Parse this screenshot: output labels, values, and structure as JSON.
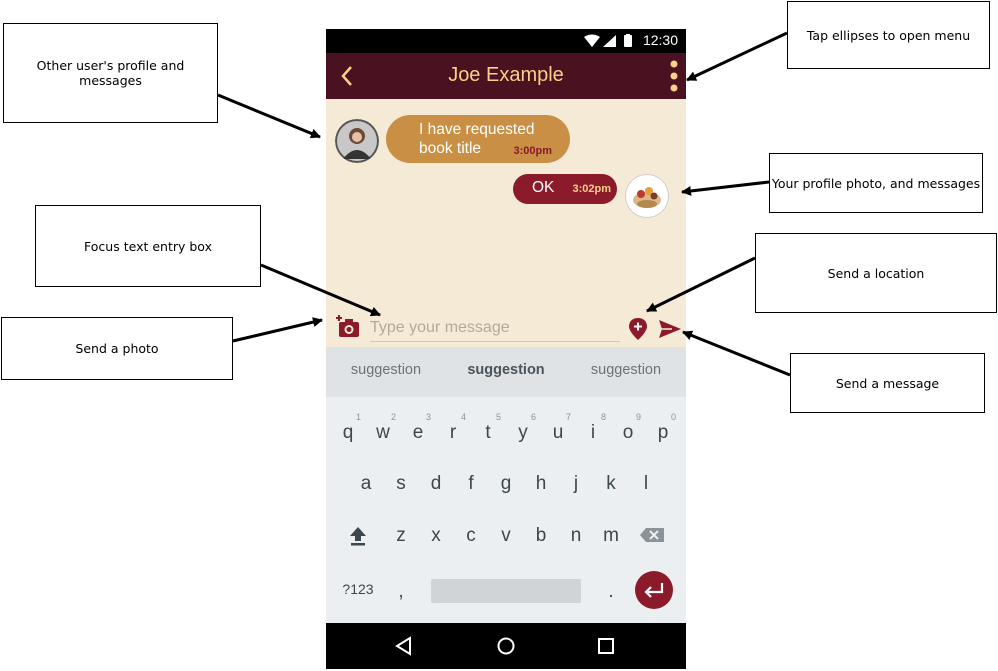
{
  "callouts": {
    "other_user": "Other user's profile and messages",
    "menu": "Tap ellipses to open menu",
    "your_profile": "Your profile photo, and messages",
    "focus_text": "Focus text entry box",
    "send_location": "Send a location",
    "send_photo": "Send a photo",
    "send_message": "Send a message"
  },
  "status": {
    "time": "12:30"
  },
  "app": {
    "title": "Joe Example"
  },
  "chat": {
    "incoming": {
      "text": "I have requested book title",
      "time": "3:00pm"
    },
    "outgoing": {
      "text": "OK",
      "time": "3:02pm"
    }
  },
  "composer": {
    "placeholder": "Type your message"
  },
  "keyboard": {
    "suggestions": [
      "suggestion",
      "suggestion",
      "suggestion"
    ],
    "row1": [
      "q",
      "w",
      "e",
      "r",
      "t",
      "y",
      "u",
      "i",
      "o",
      "p"
    ],
    "row1_nums": [
      "1",
      "2",
      "3",
      "4",
      "5",
      "6",
      "7",
      "8",
      "9",
      "0"
    ],
    "row2": [
      "a",
      "s",
      "d",
      "f",
      "g",
      "h",
      "j",
      "k",
      "l"
    ],
    "row3": [
      "z",
      "x",
      "c",
      "v",
      "b",
      "n",
      "m"
    ],
    "symbols_key": "?123",
    "comma_key": ",",
    "period_key": "."
  },
  "colors": {
    "appbar": "#4a1220",
    "title": "#f7d08a",
    "incoming_bubble": "#c98f45",
    "outgoing_bubble": "#8b1a2a",
    "chat_background": "#f5ead6"
  }
}
